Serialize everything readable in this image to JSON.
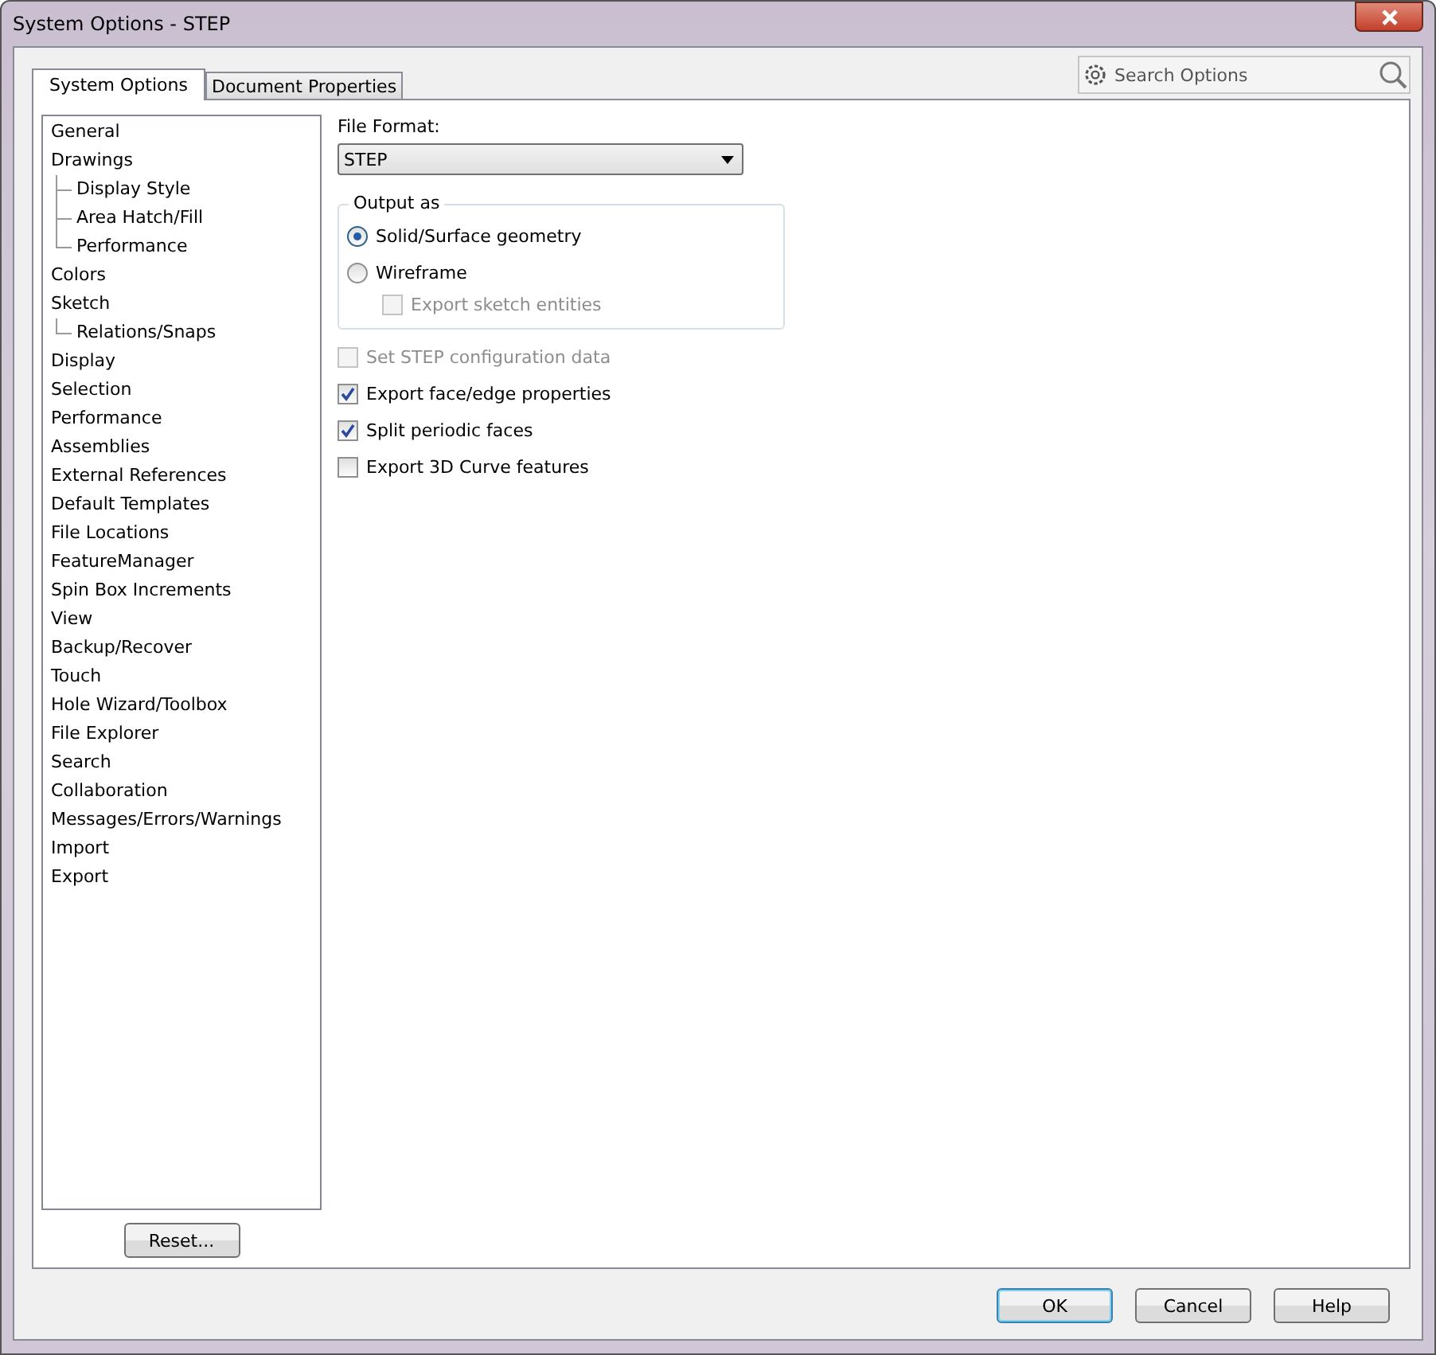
{
  "window": {
    "title": "System Options - STEP"
  },
  "tabs": [
    {
      "label": "System Options",
      "selected": true
    },
    {
      "label": "Document Properties",
      "selected": false
    }
  ],
  "search": {
    "placeholder": "Search Options"
  },
  "tree": [
    {
      "label": "General"
    },
    {
      "label": "Drawings",
      "children": [
        {
          "label": "Display Style"
        },
        {
          "label": "Area Hatch/Fill"
        },
        {
          "label": "Performance"
        }
      ]
    },
    {
      "label": "Colors"
    },
    {
      "label": "Sketch",
      "children": [
        {
          "label": "Relations/Snaps"
        }
      ]
    },
    {
      "label": "Display"
    },
    {
      "label": "Selection"
    },
    {
      "label": "Performance"
    },
    {
      "label": "Assemblies"
    },
    {
      "label": "External References"
    },
    {
      "label": "Default Templates"
    },
    {
      "label": "File Locations"
    },
    {
      "label": "FeatureManager"
    },
    {
      "label": "Spin Box Increments"
    },
    {
      "label": "View"
    },
    {
      "label": "Backup/Recover"
    },
    {
      "label": "Touch"
    },
    {
      "label": "Hole Wizard/Toolbox"
    },
    {
      "label": "File Explorer"
    },
    {
      "label": "Search"
    },
    {
      "label": "Collaboration"
    },
    {
      "label": "Messages/Errors/Warnings"
    },
    {
      "label": "Import"
    },
    {
      "label": "Export"
    }
  ],
  "file_format": {
    "label": "File Format:",
    "value": "STEP"
  },
  "output_as": {
    "title": "Output as",
    "options": [
      {
        "label": "Solid/Surface geometry",
        "selected": true
      },
      {
        "label": "Wireframe",
        "selected": false
      }
    ],
    "sub_option": {
      "label": "Export sketch entities",
      "checked": false,
      "disabled": true
    }
  },
  "checkboxes": [
    {
      "label": "Set STEP configuration data",
      "checked": false,
      "disabled": true
    },
    {
      "label": "Export face/edge properties",
      "checked": true,
      "disabled": false
    },
    {
      "label": "Split periodic faces",
      "checked": true,
      "disabled": false
    },
    {
      "label": "Export 3D Curve features",
      "checked": false,
      "disabled": false
    }
  ],
  "reset_button": "Reset...",
  "buttons": [
    {
      "label": "OK",
      "default": true
    },
    {
      "label": "Cancel",
      "default": false
    },
    {
      "label": "Help",
      "default": false
    }
  ]
}
